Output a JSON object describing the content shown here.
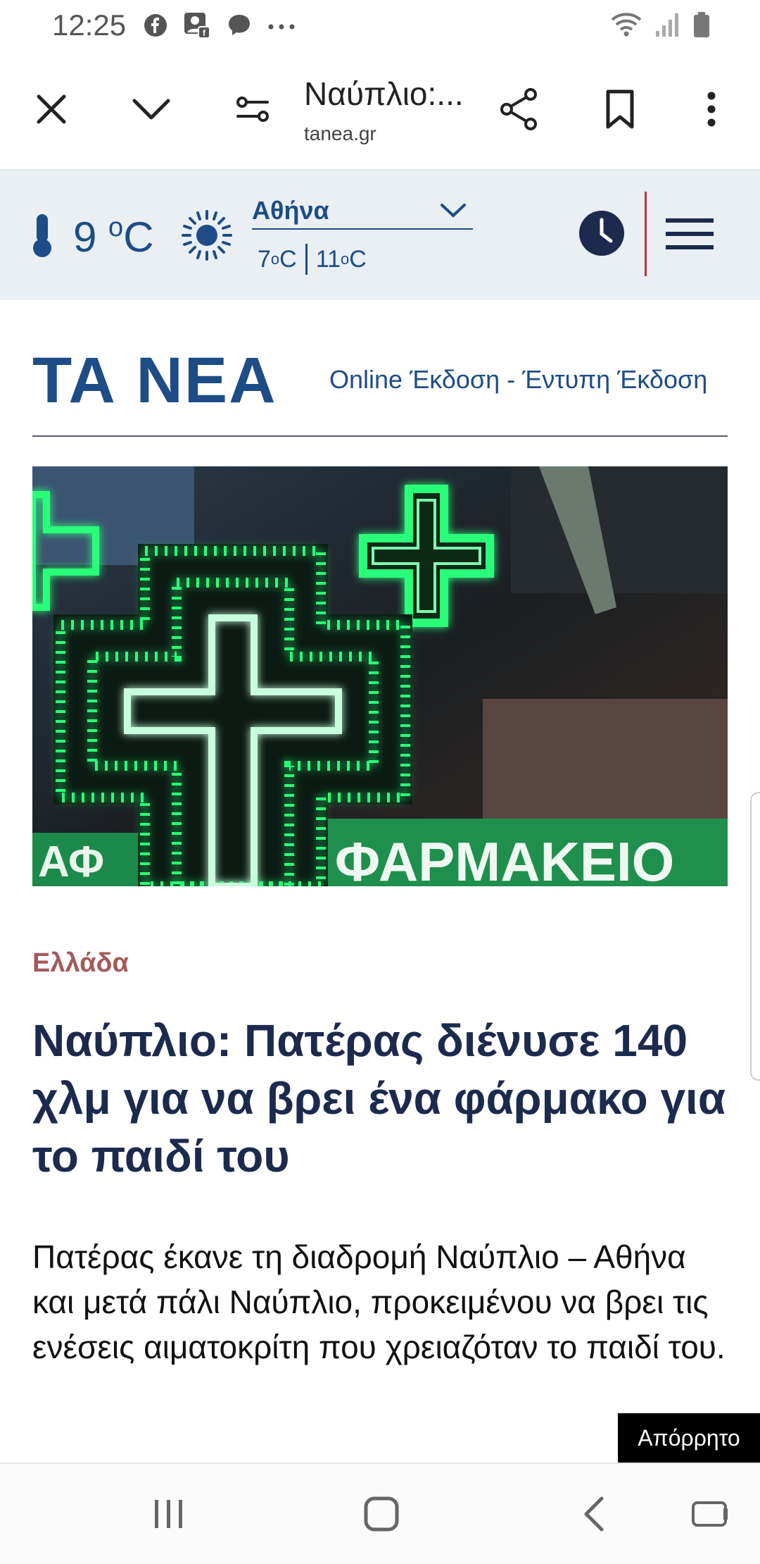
{
  "status_bar": {
    "time": "12:25",
    "left_icons": [
      "facebook-icon",
      "facebook-photo-icon",
      "messenger-icon",
      "more-dots-icon"
    ],
    "right_icons": [
      "wifi-icon",
      "signal-icon",
      "battery-icon"
    ]
  },
  "toolbar": {
    "tab_title": "Ναύπλιο:...",
    "url": "tanea.gr",
    "icons": [
      "close-icon",
      "chevron-down-icon",
      "page-settings-icon",
      "share-icon",
      "bookmark-icon",
      "more-vertical-icon"
    ]
  },
  "weather": {
    "temp_value": "9 ",
    "temp_unit": "o",
    "temp_unit_c": "C",
    "city": "Αθήνα",
    "low_value": "7",
    "low_unit": "o",
    "low_c": "C",
    "high_value": "11",
    "high_unit": "o",
    "high_c": "C"
  },
  "masthead": {
    "logo": "ΤΑ ΝΕΑ",
    "online_edition": "Online Έκδοση",
    "separator": " - ",
    "print_edition": "Έντυπη Έκδοση"
  },
  "hero": {
    "sign_text_left": "ΑΦ",
    "sign_text": "ΦΑΡΜΑΚΕΙΟ"
  },
  "article": {
    "category": "Ελλάδα",
    "headline": "Ναύπλιο: Πατέρας διένυσε 140 χλμ για να βρει ένα φάρμακο για το παιδί του",
    "lead": "Πατέρας έκανε τη διαδρομή Ναύπλιο – Αθήνα και μετά πάλι Ναύπλιο, προκειμένου να βρει τις ενέσεις αιματοκρίτη που χρειαζόταν το παιδί του."
  },
  "privacy_button": "Απόρρητο",
  "colors": {
    "brand_blue": "#1e4c86",
    "category_red": "#a45a5a",
    "weather_bg": "#e9eff2",
    "pharmacy_green": "#2bff7a"
  },
  "navbar": {
    "icons": [
      "recent-apps-icon",
      "home-icon",
      "back-icon",
      "keyboard-switch-icon"
    ]
  }
}
